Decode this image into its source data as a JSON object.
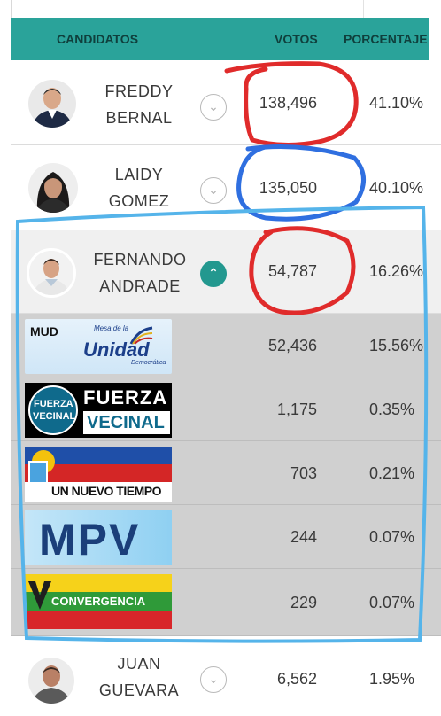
{
  "header": {
    "candidates": "CANDIDATOS",
    "votes": "VOTOS",
    "percentage": "PORCENTAJE"
  },
  "candidates": [
    {
      "first": "FREDDY",
      "last": "BERNAL",
      "votes": "138,496",
      "pct": "41.10%"
    },
    {
      "first": "LAIDY",
      "last": "GOMEZ",
      "votes": "135,050",
      "pct": "40.10%"
    },
    {
      "first": "FERNANDO",
      "last": "ANDRADE",
      "votes": "54,787",
      "pct": "16.26%"
    },
    {
      "first": "JUAN",
      "last": "GUEVARA",
      "votes": "6,562",
      "pct": "1.95%"
    }
  ],
  "parties": [
    {
      "votes": "52,436",
      "pct": "15.56%",
      "logo": {
        "a": "MUD",
        "b": "Mesa de la",
        "c": "Unidad",
        "d": "Democrática"
      }
    },
    {
      "votes": "1,175",
      "pct": "0.35%",
      "logo": {
        "a": "FUERZA",
        "b": "VECINAL",
        "c": "FUERZA",
        "d": "VECINAL"
      }
    },
    {
      "votes": "703",
      "pct": "0.21%",
      "logo": {
        "a": "UN NUEVO TIEMPO"
      }
    },
    {
      "votes": "244",
      "pct": "0.07%",
      "logo": {
        "a": "MPV"
      }
    },
    {
      "votes": "229",
      "pct": "0.07%",
      "logo": {
        "a": "CONVERGENCIA"
      }
    }
  ],
  "colors": {
    "header_bg": "#2aa39a",
    "accent": "#23988f",
    "red_mark": "#e02b2b",
    "blue_mark": "#2f6fe0",
    "lightblue_mark": "#55b4ea"
  }
}
